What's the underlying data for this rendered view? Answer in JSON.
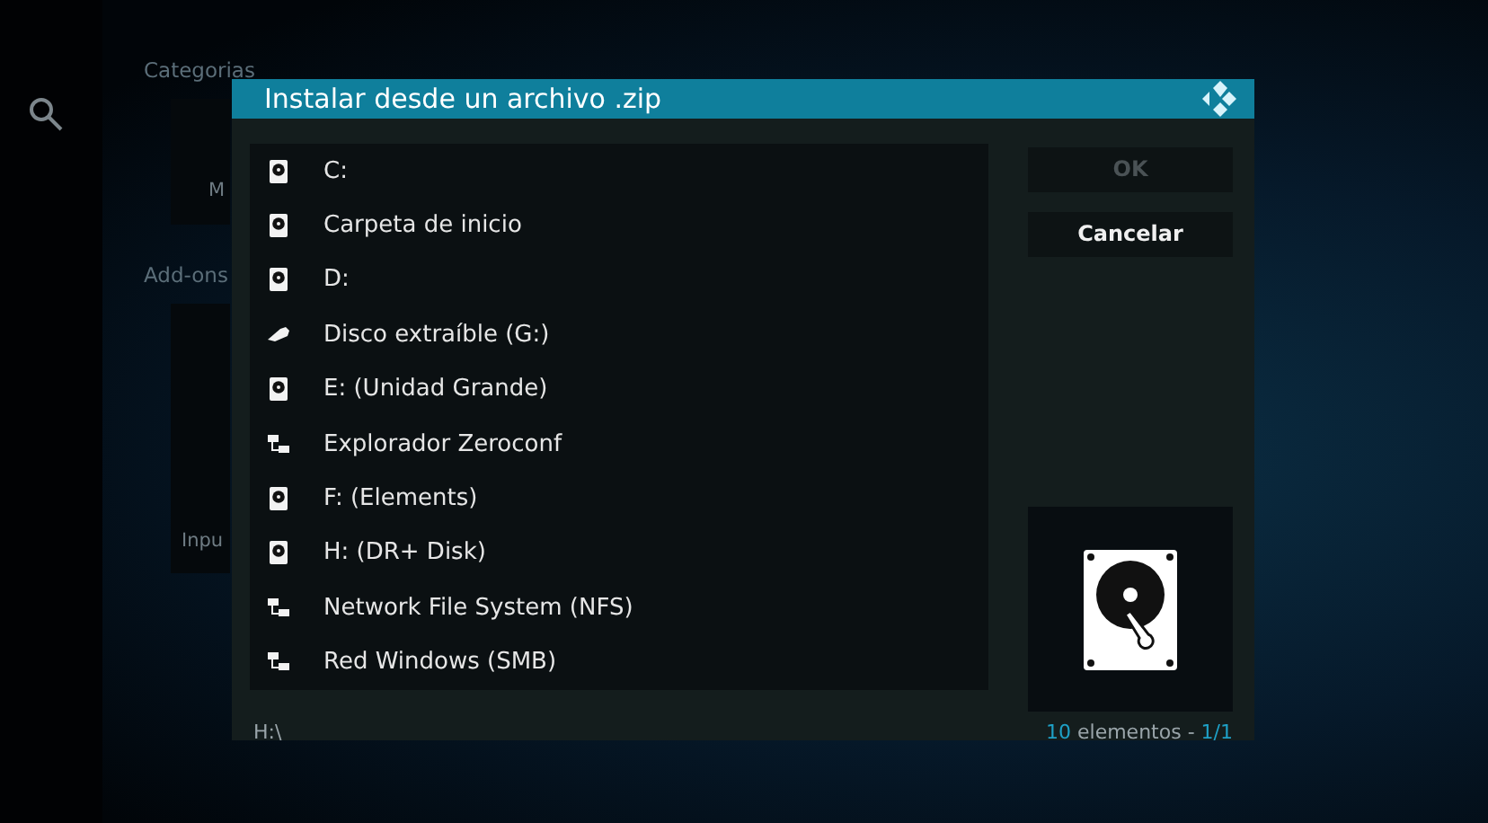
{
  "background": {
    "sections": [
      {
        "title": "Categorias",
        "tile_text": "M"
      },
      {
        "title": "Add-ons",
        "tile_text": "Inpu"
      }
    ]
  },
  "dialog": {
    "title": "Instalar desde un archivo .zip",
    "items": [
      {
        "kind": "drive",
        "label": "C:"
      },
      {
        "kind": "drive",
        "label": "Carpeta de inicio"
      },
      {
        "kind": "drive",
        "label": "D:"
      },
      {
        "kind": "removable",
        "label": "Disco extraíble (G:)"
      },
      {
        "kind": "drive",
        "label": "E: (Unidad Grande)"
      },
      {
        "kind": "network",
        "label": "Explorador Zeroconf"
      },
      {
        "kind": "drive",
        "label": "F: (Elements)"
      },
      {
        "kind": "drive",
        "label": "H: (DR+ Disk)"
      },
      {
        "kind": "network",
        "label": "Network File System (NFS)"
      },
      {
        "kind": "network",
        "label": "Red Windows (SMB)"
      }
    ],
    "buttons": [
      {
        "label": "OK",
        "disabled": true
      },
      {
        "label": "Cancelar",
        "disabled": false
      }
    ],
    "path": "H:\\",
    "count": "10",
    "count_label": "elementos -",
    "page": "1/1"
  }
}
